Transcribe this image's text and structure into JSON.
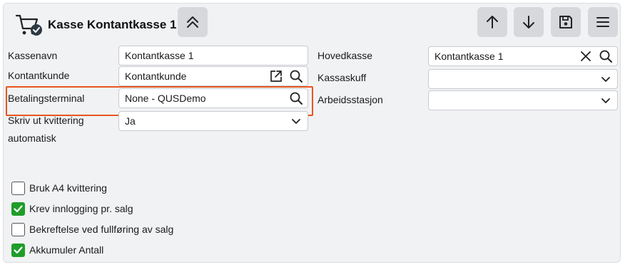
{
  "header": {
    "title": "Kasse Kontantkasse 1",
    "icons": [
      "cart-check-icon",
      "chevron-double-up-icon",
      "arrow-up-icon",
      "arrow-down-icon",
      "save-icon",
      "menu-icon"
    ]
  },
  "fields": {
    "kassenavn": {
      "label": "Kassenavn",
      "value": "Kontantkasse 1"
    },
    "kontantkunde": {
      "label": "Kontantkunde",
      "value": "Kontantkunde"
    },
    "betalingsterminal": {
      "label": "Betalingsterminal",
      "value": "None - QUSDemo"
    },
    "skriv_ut": {
      "label_line1": "Skriv ut kvittering",
      "label_line2": "automatisk",
      "value": "Ja"
    },
    "hovedkasse": {
      "label": "Hovedkasse",
      "value": "Kontantkasse 1"
    },
    "kassaskuff": {
      "label": "Kassaskuff",
      "value": ""
    },
    "arbeidsstasjon": {
      "label": "Arbeidsstasjon",
      "value": ""
    }
  },
  "checkboxes": [
    {
      "label": "Bruk A4 kvittering",
      "checked": false
    },
    {
      "label": "Krev innlogging pr. salg",
      "checked": true
    },
    {
      "label": "Bekreftelse ved fullføring av salg",
      "checked": false
    },
    {
      "label": "Akkumuler Antall",
      "checked": true
    }
  ],
  "colors": {
    "highlight": "#e8561f",
    "check": "#1f9d2a",
    "button": "#d6d8dc"
  }
}
